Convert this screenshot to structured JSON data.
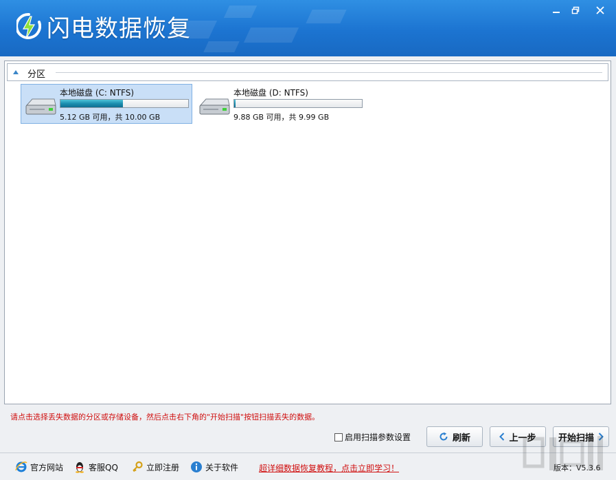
{
  "app": {
    "title": "闪电数据恢复"
  },
  "window_controls": {
    "minimize": "minimize-icon",
    "restore": "restore-icon",
    "close": "close-icon"
  },
  "section": {
    "label": "分区"
  },
  "partitions": [
    {
      "name": "本地磁盘 (C: NTFS)",
      "info": "5.12 GB 可用，共 10.00 GB",
      "used_fraction": 0.488,
      "selected": true
    },
    {
      "name": "本地磁盘 (D: NTFS)",
      "info": "9.88 GB 可用，共 9.99 GB",
      "used_fraction": 0.011,
      "selected": false
    }
  ],
  "hint": "请点击选择丢失数据的分区或存储设备，然后点击右下角的\"开始扫描\"按钮扫描丢失的数据。",
  "controls": {
    "scan_settings_label": "启用扫描参数设置",
    "scan_settings_checked": false,
    "refresh": "刷新",
    "back": "上一步",
    "start_scan": "开始扫描"
  },
  "footer": {
    "website": "官方网站",
    "support_qq": "客服QQ",
    "register": "立即注册",
    "about": "关于软件",
    "tutorial_link": "超详细数据恢复教程，点击立即学习！",
    "version": "版本：V5.3.6"
  },
  "colors": {
    "title_bar": "#1c74d1",
    "hint": "#d01010",
    "selected_partition": "#c9dff7",
    "bar_fill": "#1c8fb0"
  }
}
